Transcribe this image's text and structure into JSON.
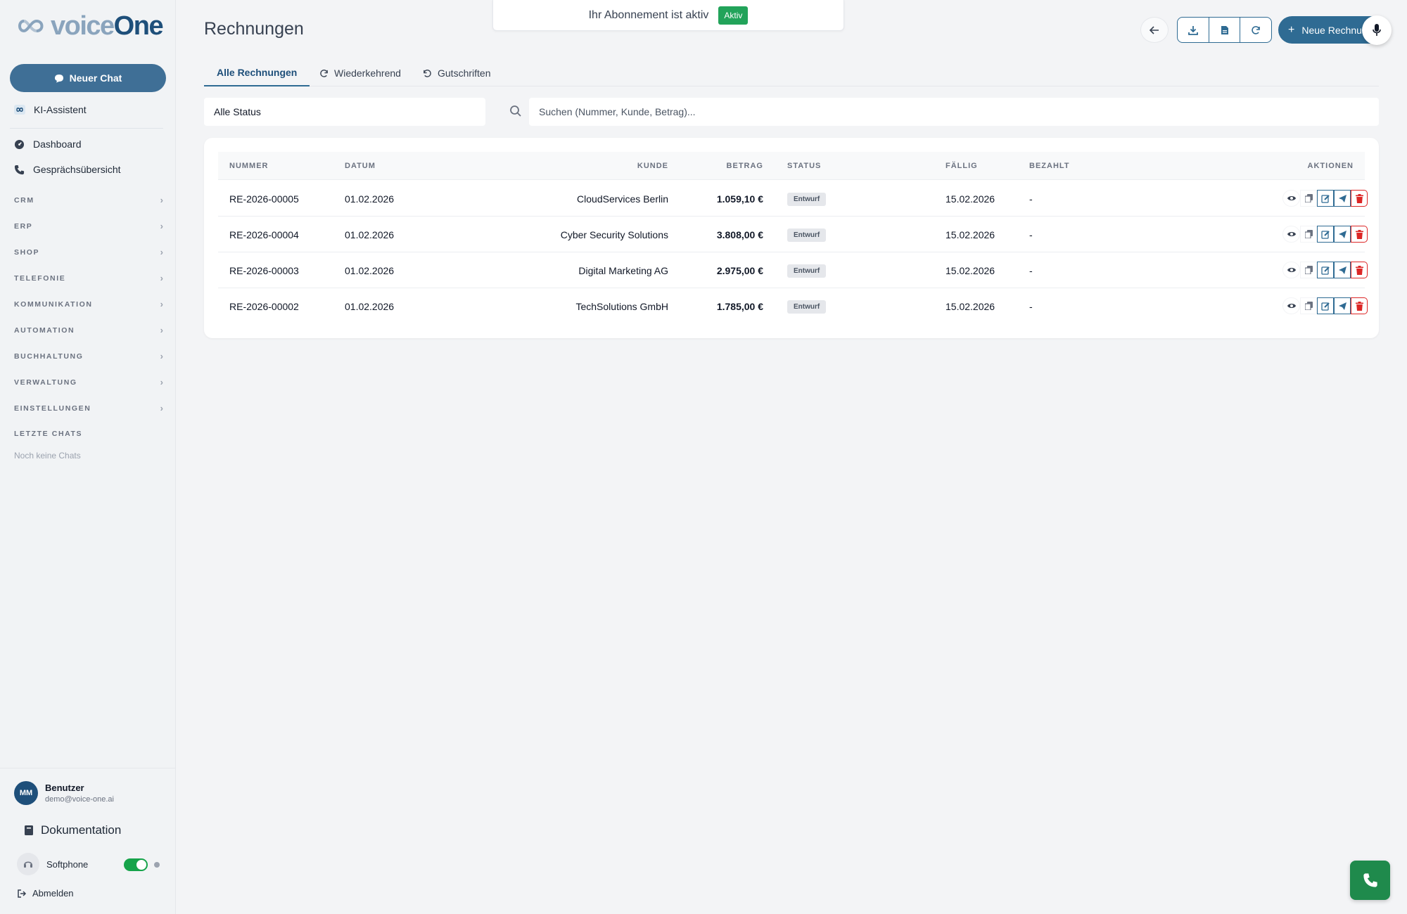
{
  "brand": {
    "name_light": "voice",
    "name_bold": "One"
  },
  "sidebar": {
    "new_chat_label": "Neuer Chat",
    "ai_assistant_label": "KI-Assistent",
    "nav": [
      {
        "label": "Dashboard",
        "icon": "dashboard-icon"
      },
      {
        "label": "Gesprächsübersicht",
        "icon": "phone-icon"
      }
    ],
    "sections": [
      "CRM",
      "ERP",
      "SHOP",
      "TELEFONIE",
      "KOMMUNIKATION",
      "AUTOMATION",
      "BUCHHALTUNG",
      "VERWALTUNG",
      "EINSTELLUNGEN"
    ],
    "recent_chats_title": "LETZTE CHATS",
    "recent_chats_empty": "Noch keine Chats",
    "user": {
      "initials": "MM",
      "name": "Benutzer",
      "email": "demo@voice-one.ai"
    },
    "documentation_label": "Dokumentation",
    "softphone_label": "Softphone",
    "softphone_enabled": true,
    "logout_label": "Abmelden"
  },
  "banner": {
    "text": "Ihr Abonnement ist aktiv",
    "badge": "Aktiv",
    "badge_color": "#22a35a"
  },
  "header": {
    "title": "Rechnungen",
    "new_button_label": "Neue Rechnung"
  },
  "tabs": [
    {
      "label": "Alle Rechnungen",
      "active": true
    },
    {
      "label": "Wiederkehrend",
      "active": false
    },
    {
      "label": "Gutschriften",
      "active": false
    }
  ],
  "filter": {
    "status_value": "Alle Status",
    "search_placeholder": "Suchen (Nummer, Kunde, Betrag)..."
  },
  "table": {
    "columns": [
      "NUMMER",
      "DATUM",
      "KUNDE",
      "BETRAG",
      "STATUS",
      "FÄLLIG",
      "BEZAHLT",
      "AKTIONEN"
    ],
    "rows": [
      {
        "nummer": "RE-2026-00005",
        "datum": "01.02.2026",
        "kunde": "CloudServices Berlin",
        "betrag": "1.059,10 €",
        "status": "Entwurf",
        "faellig": "15.02.2026",
        "bezahlt": "-"
      },
      {
        "nummer": "RE-2026-00004",
        "datum": "01.02.2026",
        "kunde": "Cyber Security Solutions",
        "betrag": "3.808,00 €",
        "status": "Entwurf",
        "faellig": "15.02.2026",
        "bezahlt": "-"
      },
      {
        "nummer": "RE-2026-00003",
        "datum": "01.02.2026",
        "kunde": "Digital Marketing AG",
        "betrag": "2.975,00 €",
        "status": "Entwurf",
        "faellig": "15.02.2026",
        "bezahlt": "-"
      },
      {
        "nummer": "RE-2026-00002",
        "datum": "01.02.2026",
        "kunde": "TechSolutions GmbH",
        "betrag": "1.785,00 €",
        "status": "Entwurf",
        "faellig": "15.02.2026",
        "bezahlt": "-"
      }
    ]
  },
  "colors": {
    "primary": "#2f6b93",
    "brand_dark": "#1e4f7a",
    "success": "#22a35a",
    "danger": "#dc2626"
  }
}
